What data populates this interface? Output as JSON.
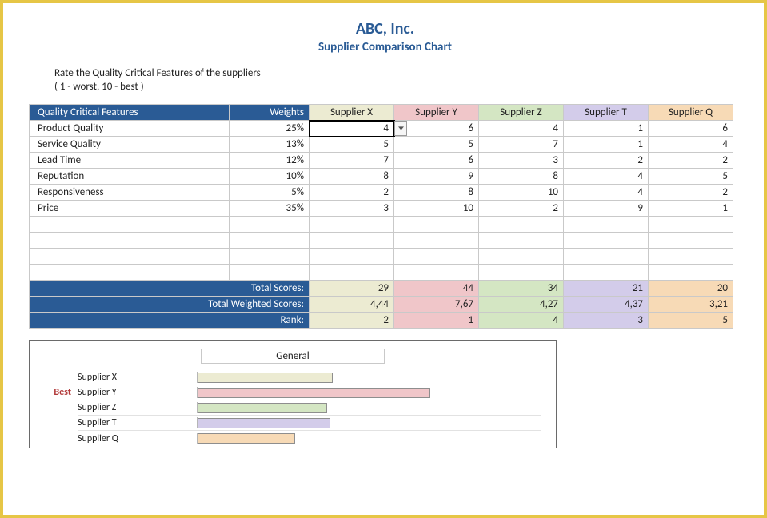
{
  "title": "ABC, Inc.",
  "subtitle": "Supplier Comparison Chart",
  "instruction_line1": "Rate the Quality Critical Features of the suppliers",
  "instruction_line2": "( 1 - worst, 10 - best )",
  "header": {
    "features": "Quality Critical Features",
    "weights": "Weights",
    "suppliers": [
      "Supplier X",
      "Supplier Y",
      "Supplier Z",
      "Supplier T",
      "Supplier Q"
    ]
  },
  "rows": [
    {
      "feature": "Product Quality",
      "weight": "25%",
      "v": [
        "4",
        "6",
        "4",
        "1",
        "6"
      ]
    },
    {
      "feature": "Service Quality",
      "weight": "13%",
      "v": [
        "5",
        "5",
        "7",
        "1",
        "4"
      ]
    },
    {
      "feature": "Lead Time",
      "weight": "12%",
      "v": [
        "7",
        "6",
        "3",
        "2",
        "2"
      ]
    },
    {
      "feature": "Reputation",
      "weight": "10%",
      "v": [
        "8",
        "9",
        "8",
        "4",
        "5"
      ]
    },
    {
      "feature": "Responsiveness",
      "weight": "5%",
      "v": [
        "2",
        "8",
        "10",
        "4",
        "2"
      ]
    },
    {
      "feature": "Price",
      "weight": "35%",
      "v": [
        "3",
        "10",
        "2",
        "9",
        "1"
      ]
    }
  ],
  "totals": {
    "scores_label": "Total Scores:",
    "scores": [
      "29",
      "44",
      "34",
      "21",
      "20"
    ],
    "weighted_label": "Total Weighted Scores:",
    "weighted": [
      "4,44",
      "7,67",
      "4,27",
      "4,37",
      "3,21"
    ],
    "rank_label": "Rank:",
    "rank": [
      "2",
      "1",
      "4",
      "3",
      "5"
    ]
  },
  "chart_data": {
    "type": "bar",
    "title": "General",
    "categories": [
      "Supplier X",
      "Supplier Y",
      "Supplier Z",
      "Supplier T",
      "Supplier Q"
    ],
    "values": [
      4.44,
      7.67,
      4.27,
      4.37,
      3.21
    ],
    "best_label": "Best",
    "best_index": 1,
    "colors": [
      "#ecebd2",
      "#f0c6c9",
      "#d4e6c3",
      "#d3ccea",
      "#f7dab6"
    ],
    "xmax": 10
  }
}
